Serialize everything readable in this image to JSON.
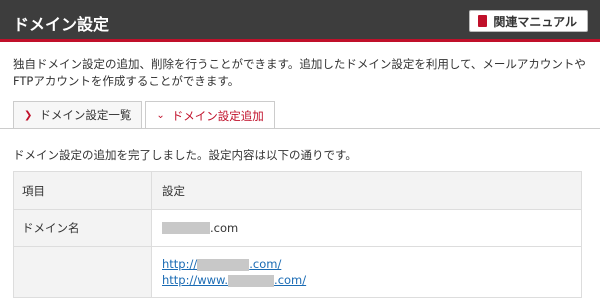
{
  "header": {
    "title": "ドメイン設定",
    "manual_label": "関連マニュアル"
  },
  "description": "独自ドメイン設定の追加、削除を行うことができます。追加したドメイン設定を利用して、メールアカウントやFTPアカウントを作成することができます。",
  "tabs": [
    {
      "label": "ドメイン設定一覧",
      "active": false
    },
    {
      "label": "ドメイン設定追加",
      "active": true
    }
  ],
  "completion_message": "ドメイン設定の追加を完了しました。設定内容は以下の通りです。",
  "table": {
    "headers": {
      "item": "項目",
      "setting": "設定"
    },
    "rows": [
      {
        "label": "ドメイン名",
        "value_suffix": ".com"
      },
      {
        "label": "",
        "links": [
          {
            "prefix": "http://",
            "suffix": ".com/"
          },
          {
            "prefix": "http://www.",
            "suffix": ".com/"
          }
        ]
      }
    ]
  }
}
